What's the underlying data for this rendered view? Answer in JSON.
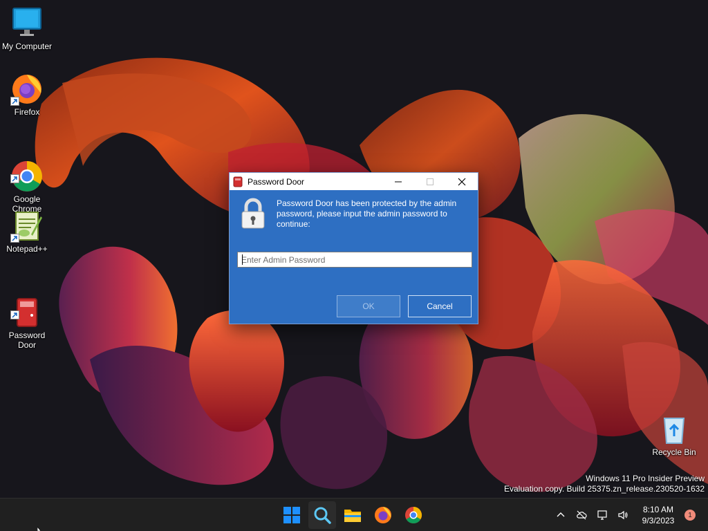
{
  "desktop": {
    "icons": [
      {
        "label": "My Computer"
      },
      {
        "label": "Firefox"
      },
      {
        "label": "Google\nChrome"
      },
      {
        "label": "Notepad++"
      },
      {
        "label": "Password\nDoor"
      },
      {
        "label": "Recycle Bin"
      }
    ],
    "watermark": {
      "line1": "Windows 11 Pro Insider Preview",
      "line2": "Evaluation copy. Build 25375.zn_release.230520-1632"
    }
  },
  "dialog": {
    "title": "Password Door",
    "message": "Password Door has been protected by the admin password, please input the admin password to continue:",
    "password_placeholder": "Enter Admin Password",
    "password_value": "",
    "ok_label": "OK",
    "ok_enabled": false,
    "cancel_label": "Cancel"
  },
  "taskbar": {
    "pinned": [
      "start-icon",
      "search-icon",
      "file-explorer-icon",
      "firefox-icon",
      "chrome-icon"
    ],
    "tray": [
      "chevron-up-icon",
      "cloud-offline-icon",
      "network-icon",
      "volume-icon"
    ],
    "time": "8:10 AM",
    "date": "9/3/2023",
    "notification_count": "1"
  },
  "colors": {
    "dialog_bg": "#2e6fc2",
    "taskbar_bg": "#202020",
    "wallpaper_bg": "#17161c"
  }
}
